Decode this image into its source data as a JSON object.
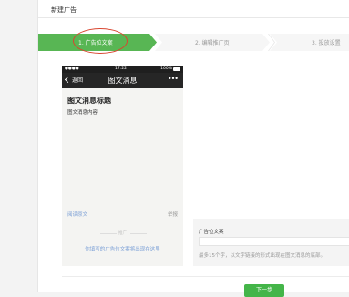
{
  "page": {
    "title": "新建广告"
  },
  "steps": [
    {
      "label": "1. 广告位文案",
      "active": true
    },
    {
      "label": "2. 编辑推广页",
      "active": false
    },
    {
      "label": "3. 投放设置",
      "active": false
    }
  ],
  "colors": {
    "step_active": "#58b654",
    "highlight_oval": "#d9452f",
    "link_blue": "#7a9fd6",
    "button_green": "#44b549"
  },
  "phone": {
    "status": {
      "signal": "●●●●",
      "time": "17:22",
      "battery": "100%"
    },
    "nav": {
      "back_label": "返回",
      "title": "图文消息",
      "more": "•••"
    },
    "message": {
      "title": "图文消息标题",
      "body": "图文消息内容"
    },
    "footer": {
      "read_more": "阅读原文",
      "report": "举报"
    },
    "ad": {
      "divider_label": "推广",
      "copy": "你填写的广告位文案将出现在这里"
    }
  },
  "form": {
    "label": "广告位文案",
    "value": "",
    "hint": "最多15个字，以文字链接的形式出现在图文消息的底部。"
  },
  "actions": {
    "next_label": "下一步"
  }
}
